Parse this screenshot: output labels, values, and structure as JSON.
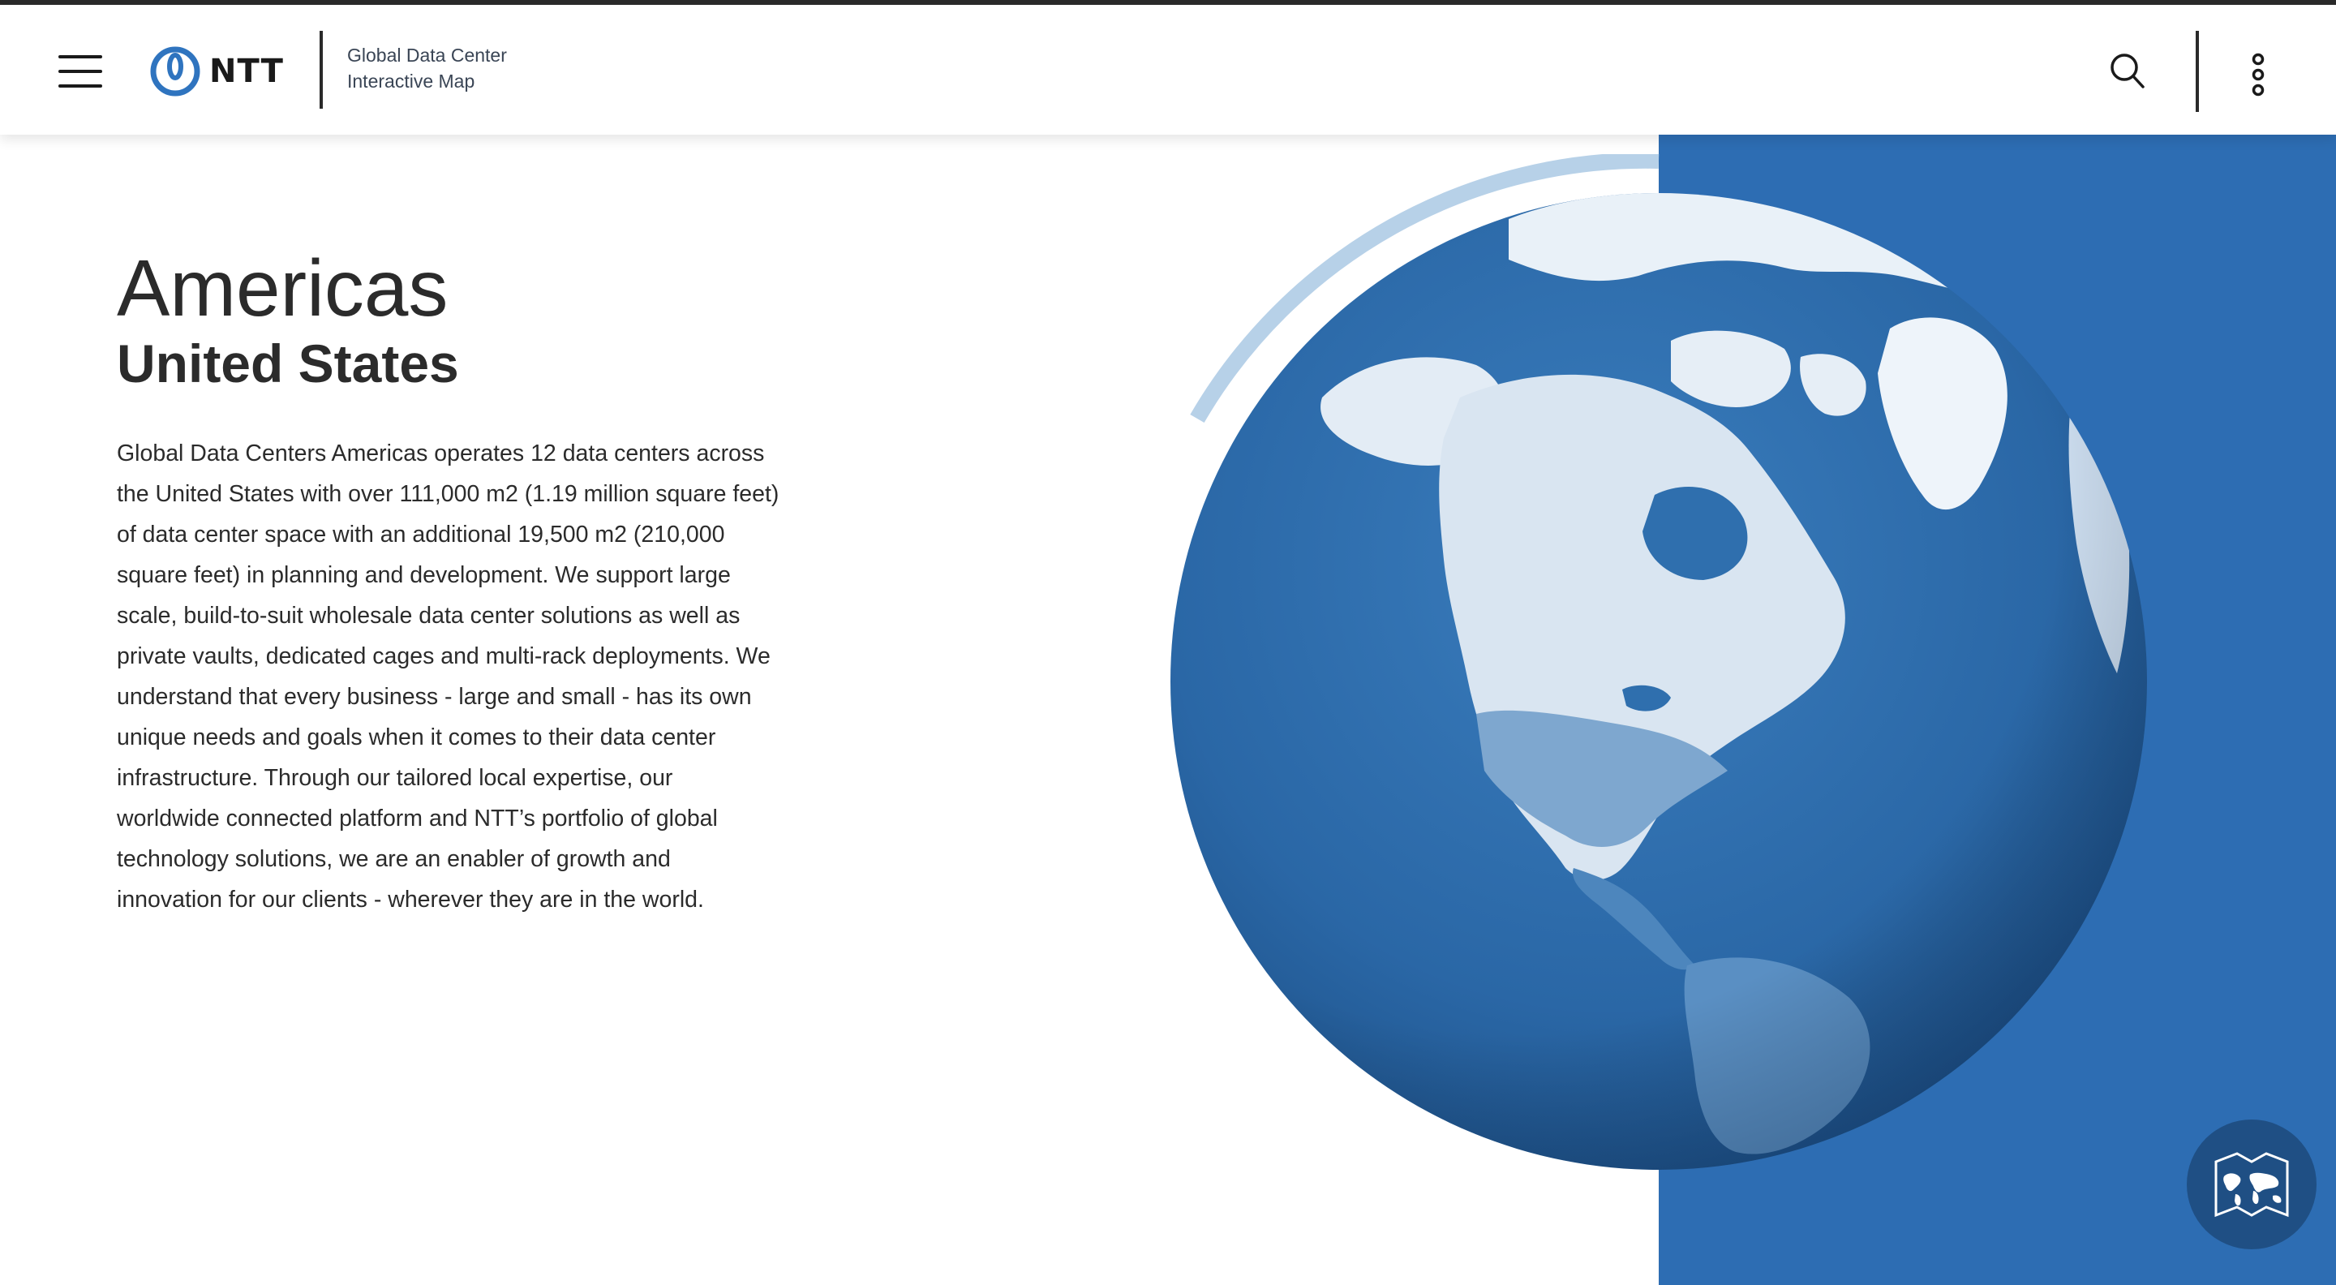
{
  "header": {
    "menu_icon": "hamburger-menu-icon",
    "logo_text": "NTT",
    "logo_icon": "ntt-logo-icon",
    "app_title_line1": "Global Data Center",
    "app_title_line2": "Interactive Map",
    "search_icon": "search-icon",
    "more_icon": "vertical-dots-icon"
  },
  "content": {
    "region": "Americas",
    "country": "United States",
    "description": "Global Data Centers Americas operates 12 data centers across the United States with over 111,000 m2 (1.19 million square feet) of data center space with an additional 19,500 m2 (210,000 square feet) in planning and development. We support large scale, build-to-suit wholesale data center solutions as well as private vaults, dedicated cages and multi-rack deployments. We understand that every business - large and small - has its own unique needs and goals when it comes to their data center infrastructure. Through our tailored local expertise, our worldwide connected platform and NTT’s portfolio of global technology solutions, we are an enabler of growth and innovation for our clients - wherever they are in the world."
  },
  "globe": {
    "icon": "globe-americas-icon"
  },
  "map_button": {
    "icon": "world-map-icon"
  },
  "colors": {
    "brand_blue": "#2d6db3",
    "ocean_blue": "#2b6aa8",
    "fab_blue": "#1f4f84",
    "text": "#2b2b2b"
  }
}
